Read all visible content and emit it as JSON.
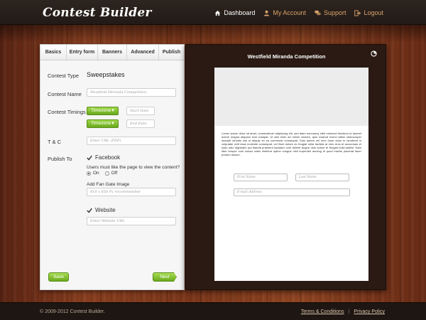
{
  "app": {
    "logo": "Contest Builder"
  },
  "nav": {
    "dashboard": "Dashboard",
    "account": "My Account",
    "support": "Support",
    "logout": "Logout"
  },
  "tabs": [
    "Basics",
    "Entry form",
    "Banners",
    "Advanced",
    "Publish"
  ],
  "form": {
    "contest_type_label": "Contest Type",
    "contest_type_value": "Sweepstakes",
    "contest_name_label": "Contest Name",
    "contest_name_value": "Westfield Miranda Competition",
    "timings_label": "Contest Timings",
    "timezone_label": "Timezone",
    "start_date_placeholder": "Start Date",
    "end_date_placeholder": "End Date",
    "tc_label": "T & C",
    "tc_placeholder": "Enter URL (PDF)",
    "publish_label": "Publish To",
    "facebook_label": "Facebook",
    "like_question": "Users must like the page to view the content?",
    "radio_on": "On",
    "radio_off": "Off",
    "fan_gate_label": "Add Fan Gate Image",
    "fan_gate_placeholder": "810 x 850 Px recommended",
    "website_label": "Website",
    "website_placeholder": "Enter Website URL",
    "save_label": "Save",
    "next_label": "Next"
  },
  "preview": {
    "title": "Westfield Miranda Competition",
    "lorem": "Lorem ipsum dolor sit amet, consectetuer adipiscing elit, sed diam nonummy nibh euismod tincidunt ut laoreet dolore magna aliquam erat volutpat. Ut wisi enim ad minim veniam, quis nostrud exerci tation ullamcorper suscipit lobortis nisl ut aliquip ex ea commodo consequat. Duis autem vel eum iriure dolor in hendrerit in vulputate velit esse molestie consequat, vel illum dolore eu feugiat nulla facilisis at vero eros et accumsan et iusto odio dignissim qui blandit praesent luptatum zzril delenit augue duis dolore te feugait nulla facilisi. Nam liber tempor cum soluta nobis eleifend option congue nihil imperdiet doming id quod mazim placerat facer possim assum.",
    "first_name_placeholder": "First Name",
    "last_name_placeholder": "Last Name",
    "email_placeholder": "E-mail Address"
  },
  "footer": {
    "copyright": "© 2009-2012 Contest Builder.",
    "terms": "Terms & Conditions",
    "separator": "|",
    "privacy": "Privacy Policy"
  },
  "colors": {
    "accent_green": "#7bbf2a",
    "nav_link": "#d9a36a",
    "header_bg": "#2a211c"
  }
}
